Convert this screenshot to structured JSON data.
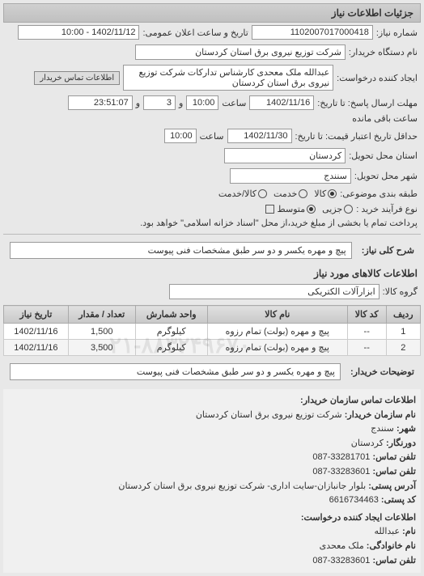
{
  "header": {
    "title": "جزئیات اطلاعات نیاز"
  },
  "form": {
    "req_no_label": "شماره نیاز:",
    "req_no": "1102007017000418",
    "announce_label": "تاریخ و ساعت اعلان عمومی:",
    "announce_value": "1402/11/12 - 10:00",
    "org_label": "نام دستگاه خریدار:",
    "org_value": "شرکت توزیع نیروی برق استان کردستان",
    "creator_label": "ایجاد کننده درخواست:",
    "creator_value": "عبدالله ملک معحدی کارشناس تدارکات شرکت توزیع نیروی برق استان کردستان",
    "buyer_contact_btn": "اطلاعات تماس خریدار",
    "deadline_label": "مهلت ارسال پاسخ: تا تاریخ:",
    "deadline_date": "1402/11/16",
    "time_label": "ساعت",
    "deadline_time": "10:00",
    "and_label": "و",
    "remain_days": "3",
    "remain_time": "23:51:07",
    "remain_suffix": "ساعت باقی مانده",
    "validity_label": "حداقل تاریخ اعتبار قیمت: تا تاریخ:",
    "validity_date": "1402/11/30",
    "validity_time": "10:00",
    "province_label": "استان محل تحویل:",
    "province_value": "کردستان",
    "city_label": "شهر محل تحویل:",
    "city_value": "سنندج",
    "type_label": "طبقه بندی موضوعی:",
    "type_goods": "کالا",
    "type_service": "خدمت",
    "type_mixed": "کالا/خدمت",
    "proc_label": "نوع فرآیند خرید :",
    "proc_partial": "جزیی",
    "proc_mid": "متوسط",
    "proc_note": "پرداخت تمام یا بخشی از مبلغ خرید،از محل \"اسناد خزانه اسلامی\" خواهد بود.",
    "desc_label": "شرح کلی نیاز:",
    "desc_value": "پیچ و مهره یکسر و دو سر طبق مشخصات فنی پیوست",
    "items_section": "اطلاعات کالاهای مورد نیاز",
    "group_label": "گروه کالا:",
    "group_value": "ابزارآلات الکتریکی",
    "buyer_notes_label": "توضیحات خریدار:",
    "buyer_notes_value": "پیچ و مهره یکسر و دو سر طبق مشخصات فنی پیوست"
  },
  "table": {
    "headers": {
      "row": "ردیف",
      "code": "کد کالا",
      "name": "نام کالا",
      "unit": "واحد شمارش",
      "qty": "تعداد / مقدار",
      "date": "تاریخ نیاز"
    },
    "rows": [
      {
        "row": "1",
        "code": "--",
        "name": "پیچ و مهره (بولت) تمام رزوه",
        "unit": "کیلوگرم",
        "qty": "1,500",
        "date": "1402/11/16"
      },
      {
        "row": "2",
        "code": "--",
        "name": "پیچ و مهره (بولت) تمام رزوه",
        "unit": "کیلوگرم",
        "qty": "3,500",
        "date": "1402/11/16"
      }
    ]
  },
  "contact": {
    "section_title": "اطلاعات تماس سازمان خریدار:",
    "org_label": "نام سازمان خریدار:",
    "org": "شرکت توزیع نیروی برق استان کردستان",
    "city_label": "شهر:",
    "city": "سنندج",
    "province_label": "دورنگار:",
    "province": "کردستان",
    "phone_label": "تلفن تماس:",
    "phone": "33281701-087",
    "fax_label": "تلفن تماس:",
    "fax": "33283601-087",
    "addr_label": "آدرس پستی:",
    "addr": "بلوار جانبازان-سایت اداری- شرکت توزیع نیروی برق استان کردستان",
    "post_label": "کد پستی:",
    "post": "6616734463",
    "creator_section": "اطلاعات ایجاد کننده درخواست:",
    "fname_label": "نام:",
    "fname": "عبدالله",
    "lname_label": "نام خانوادگی:",
    "lname": "ملک معحدی",
    "cphone_label": "تلفن تماس:",
    "cphone": "33283601-087"
  },
  "watermark": "۰۲۱-۸۸۳۲۴۹۶۷۰"
}
